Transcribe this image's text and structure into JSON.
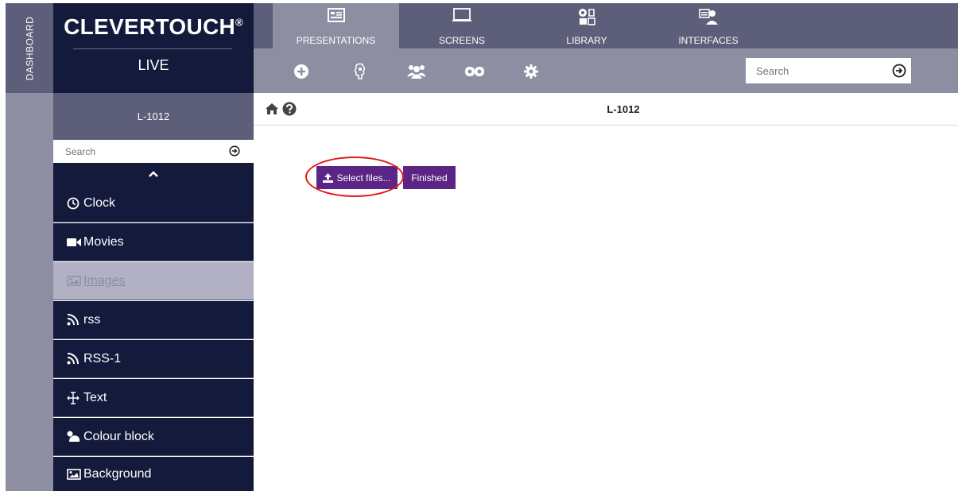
{
  "rail": {
    "label": "DASHBOARD"
  },
  "brand": {
    "name": "CLEVERTOUCH",
    "registered": "®",
    "subtitle": "LIVE"
  },
  "nav": {
    "tabs": [
      {
        "label": "PRESENTATIONS",
        "icon": "presentation-icon",
        "active": true
      },
      {
        "label": "SCREENS",
        "icon": "monitor-icon",
        "active": false
      },
      {
        "label": "LIBRARY",
        "icon": "media-library-icon",
        "active": false
      },
      {
        "label": "INTERFACES",
        "icon": "interface-user-icon",
        "active": false
      }
    ]
  },
  "toolbar": {
    "icons": [
      "plus-circle-icon",
      "brain-icon",
      "users-icon",
      "infinity-icon",
      "gear-icon"
    ],
    "search_placeholder": "Search"
  },
  "sidebar": {
    "header": "L-1012",
    "search_placeholder": "Search",
    "items": [
      {
        "label": "Clock",
        "icon": "clock-icon"
      },
      {
        "label": "Movies",
        "icon": "video-camera-icon"
      },
      {
        "label": "Images",
        "icon": "image-icon",
        "active": true
      },
      {
        "label": "rss",
        "icon": "rss-icon"
      },
      {
        "label": "RSS-1",
        "icon": "rss-icon"
      },
      {
        "label": "Text",
        "icon": "text-cursor-icon"
      },
      {
        "label": "Colour block",
        "icon": "color-bucket-icon"
      },
      {
        "label": "Background",
        "icon": "picture-icon"
      }
    ]
  },
  "content": {
    "title": "L-1012",
    "select_files_label": "Select files...",
    "finished_label": "Finished"
  },
  "colors": {
    "dark_navy": "#141a3c",
    "slate": "#5d5e79",
    "lavender_gray": "#8e8ea3",
    "purple_button": "#5a2584",
    "highlight_red": "#e3161b"
  }
}
